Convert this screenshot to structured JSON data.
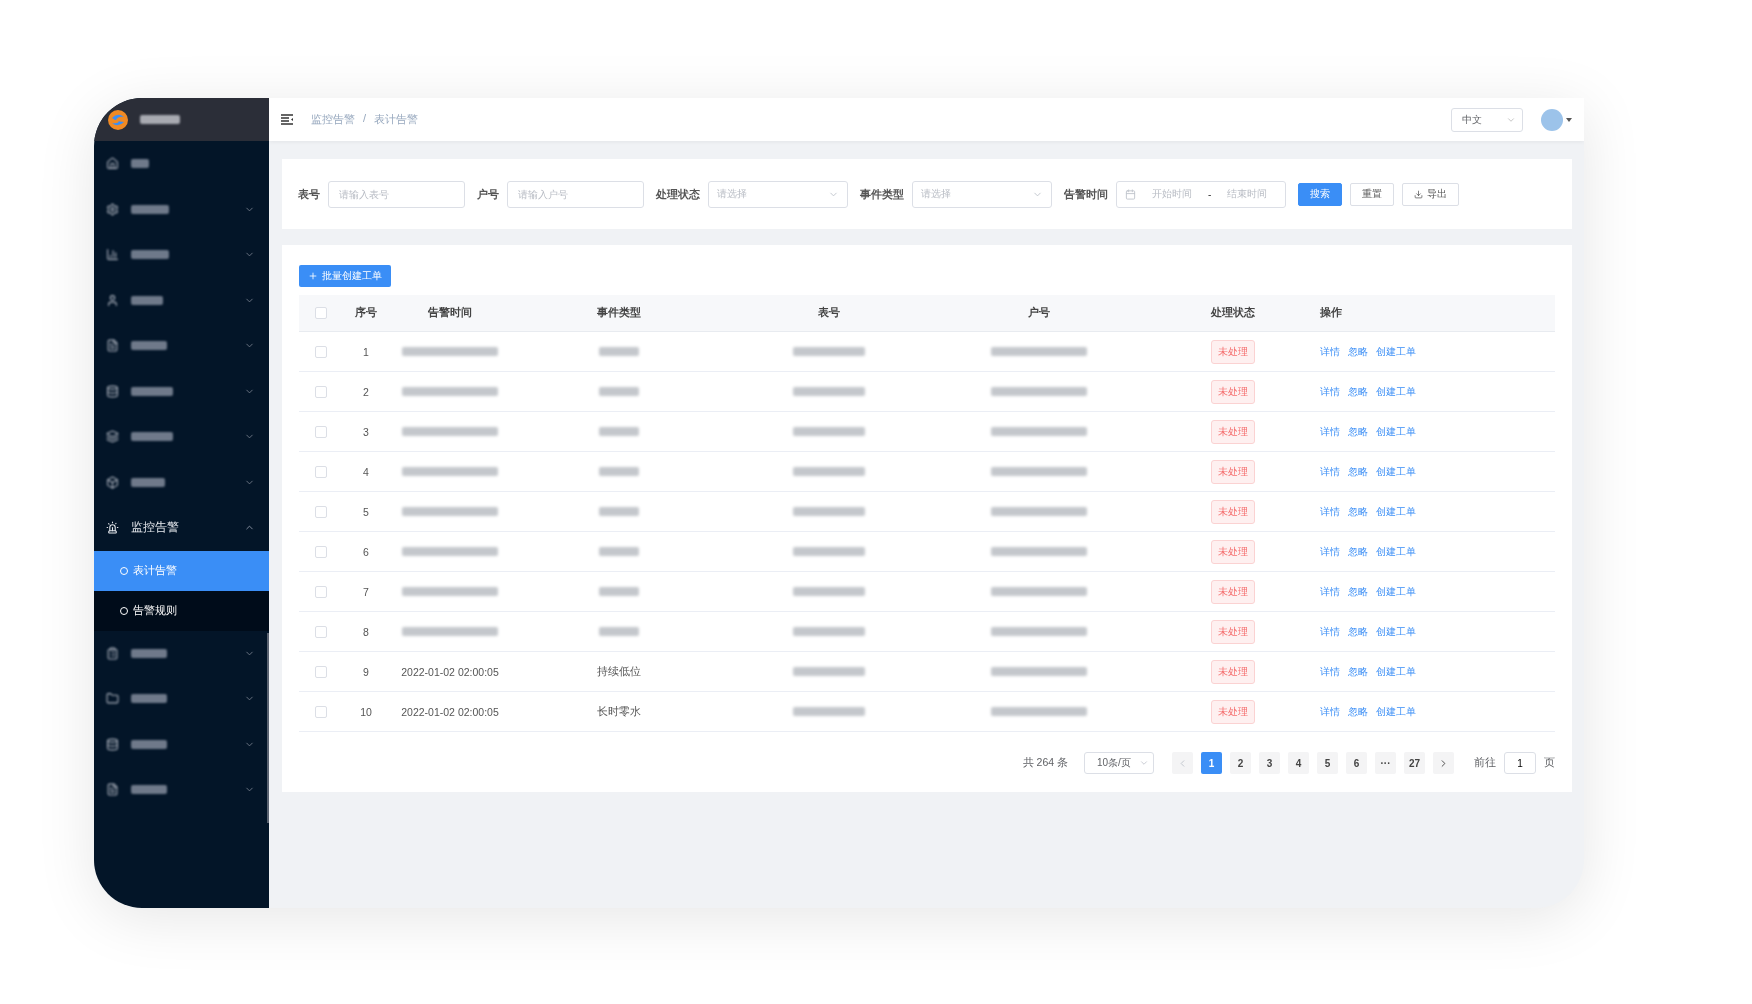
{
  "sidebar": {
    "items": [
      {
        "kind": "blurred",
        "expandable": false
      },
      {
        "kind": "blurred",
        "expandable": true,
        "expanded": false
      },
      {
        "kind": "blurred",
        "expandable": true,
        "expanded": false
      },
      {
        "kind": "blurred",
        "expandable": true,
        "expanded": false
      },
      {
        "kind": "blurred",
        "expandable": true,
        "expanded": false
      },
      {
        "kind": "blurred",
        "expandable": true,
        "expanded": false
      },
      {
        "kind": "blurred",
        "expandable": true,
        "expanded": false
      },
      {
        "kind": "blurred",
        "expandable": true,
        "expanded": false
      },
      {
        "kind": "labeled",
        "label": "监控告警",
        "expandable": true,
        "expanded": true,
        "children": [
          {
            "label": "表计告警",
            "selected": true
          },
          {
            "label": "告警规则",
            "selected": false
          }
        ]
      },
      {
        "kind": "blurred",
        "expandable": true,
        "expanded": false
      },
      {
        "kind": "blurred",
        "expandable": true,
        "expanded": false
      },
      {
        "kind": "blurred",
        "expandable": true,
        "expanded": false
      },
      {
        "kind": "blurred",
        "expandable": true,
        "expanded": false
      }
    ]
  },
  "header": {
    "breadcrumb": [
      "监控告警",
      "表计告警"
    ],
    "separator": "/",
    "language": "中文"
  },
  "filters": {
    "fields": [
      {
        "kind": "input",
        "label": "表号",
        "placeholder": "请输入表号"
      },
      {
        "kind": "input",
        "label": "户号",
        "placeholder": "请输入户号"
      },
      {
        "kind": "select",
        "label": "处理状态",
        "placeholder": "请选择"
      },
      {
        "kind": "select",
        "label": "事件类型",
        "placeholder": "请选择"
      },
      {
        "kind": "daterange",
        "label": "告警时间",
        "start_placeholder": "开始时间",
        "dash": "-",
        "end_placeholder": "结束时间"
      }
    ],
    "buttons": [
      {
        "kind": "primary",
        "label": "搜索"
      },
      {
        "kind": "plain",
        "label": "重置"
      },
      {
        "kind": "export",
        "label": "导出"
      }
    ]
  },
  "toolbar": {
    "batch_button": "批量创建工单"
  },
  "table": {
    "header_checked": false,
    "columns": [
      "序号",
      "告警时间",
      "事件类型",
      "表号",
      "户号",
      "处理状态",
      "操作"
    ],
    "rows": [
      {
        "checked": false,
        "index": "1",
        "status": "未处理",
        "actions": [
          "详情",
          "忽略",
          "创建工单"
        ]
      },
      {
        "checked": false,
        "index": "2",
        "status": "未处理",
        "actions": [
          "详情",
          "忽略",
          "创建工单"
        ]
      },
      {
        "checked": false,
        "index": "3",
        "status": "未处理",
        "actions": [
          "详情",
          "忽略",
          "创建工单"
        ]
      },
      {
        "checked": false,
        "index": "4",
        "status": "未处理",
        "actions": [
          "详情",
          "忽略",
          "创建工单"
        ]
      },
      {
        "checked": false,
        "index": "5",
        "status": "未处理",
        "actions": [
          "详情",
          "忽略",
          "创建工单"
        ]
      },
      {
        "checked": false,
        "index": "6",
        "status": "未处理",
        "actions": [
          "详情",
          "忽略",
          "创建工单"
        ]
      },
      {
        "checked": false,
        "index": "7",
        "status": "未处理",
        "actions": [
          "详情",
          "忽略",
          "创建工单"
        ]
      },
      {
        "checked": false,
        "index": "8",
        "status": "未处理",
        "actions": [
          "详情",
          "忽略",
          "创建工单"
        ]
      },
      {
        "checked": false,
        "index": "9",
        "time": "2022-01-02 02:00:05",
        "event": "持续低位",
        "status": "未处理",
        "actions": [
          "详情",
          "忽略",
          "创建工单"
        ]
      },
      {
        "checked": false,
        "index": "10",
        "time": "2022-01-02 02:00:05",
        "event": "长时零水",
        "status": "未处理",
        "actions": [
          "详情",
          "忽略",
          "创建工单"
        ]
      }
    ]
  },
  "pagination": {
    "total": "共 264 条",
    "page_size": "10条/页",
    "pages": [
      {
        "label": "1",
        "selected": true
      },
      {
        "label": "2",
        "selected": false
      },
      {
        "label": "3",
        "selected": false
      },
      {
        "label": "4",
        "selected": false
      },
      {
        "label": "5",
        "selected": false
      },
      {
        "label": "6",
        "selected": false
      },
      {
        "label": "···",
        "selected": false
      },
      {
        "label": "27",
        "selected": false
      }
    ],
    "goto_label": "前往",
    "goto_value": "1",
    "goto_suffix": "页"
  }
}
